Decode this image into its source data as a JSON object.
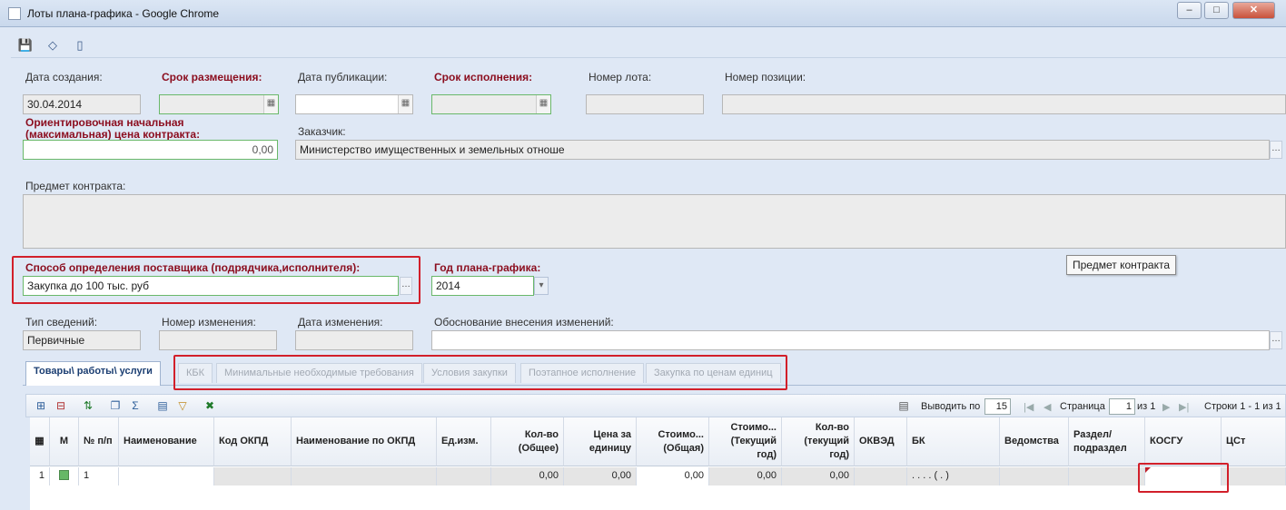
{
  "window": {
    "title": "Лоты плана-графика - Google Chrome",
    "minimize": "–",
    "maximize": "□",
    "close": "✕"
  },
  "form": {
    "creation_date": {
      "label": "Дата создания:",
      "value": "30.04.2014"
    },
    "placement_term": {
      "label": "Срок размещения:",
      "value": ""
    },
    "publication_date": {
      "label": "Дата публикации:",
      "value": ""
    },
    "execution_term": {
      "label": "Срок исполнения:",
      "value": ""
    },
    "lot_number": {
      "label": "Номер лота:",
      "value": ""
    },
    "position_number": {
      "label": "Номер позиции:",
      "value": ""
    },
    "initial_price": {
      "label_line1": "Ориентировочная начальная",
      "label_line2": "(максимальная) цена контракта:",
      "value": "0,00"
    },
    "customer": {
      "label": "Заказчик:",
      "value": "Министерство имущественных и земельных отноше"
    },
    "subject": {
      "label": "Предмет контракта:",
      "value": ""
    },
    "subject_tooltip": "Предмет контракта",
    "supplier_method": {
      "label": "Способ определения поставщика (подрядчика,исполнителя):",
      "value": "Закупка до 100 тыс. руб"
    },
    "plan_year": {
      "label": "Год плана-графика:",
      "value": "2014"
    },
    "info_type": {
      "label": "Тип сведений:",
      "value": "Первичные"
    },
    "change_number": {
      "label": "Номер изменения:",
      "value": ""
    },
    "change_date": {
      "label": "Дата изменения:",
      "value": ""
    },
    "change_reason": {
      "label": "Обоснование внесения изменений:",
      "value": ""
    }
  },
  "tabs": [
    {
      "label": "Товары\\ работы\\ услуги",
      "active": true
    },
    {
      "label": "КБК",
      "active": false
    },
    {
      "label": "Минимальные необходимые требования",
      "active": false
    },
    {
      "label": "Условия закупки",
      "active": false
    },
    {
      "label": "Поэтапное исполнение",
      "active": false
    },
    {
      "label": "Закупка по ценам единиц",
      "active": false
    }
  ],
  "grid_toolbar": {
    "show_label": "Выводить по",
    "per_page": "15",
    "page_label": "Страница",
    "page": "1",
    "of_pages": "из 1",
    "rows_info": "Строки 1 - 1 из 1"
  },
  "grid": {
    "columns": [
      "",
      "М",
      "№ п/п",
      "Наименование",
      "Код ОКПД",
      "Наименование по ОКПД",
      "Ед.изм.",
      "Кол-во\n(Общее)",
      "Цена за\nединицу",
      "Стоимо...\n(Общая)",
      "Стоимо...\n(Текущий\nгод)",
      "Кол-во\n(текущий\nгод)",
      "ОКВЭД",
      "БК",
      "Ведомства",
      "Раздел/\nподраздел",
      "КОСГУ",
      "ЦСт"
    ],
    "rows": [
      [
        "1",
        "",
        "1",
        "",
        "",
        "",
        "",
        "0,00",
        "0,00",
        "0,00",
        "0,00",
        "0,00",
        "",
        ". . . . ( . )",
        "",
        "",
        "",
        ""
      ]
    ]
  }
}
